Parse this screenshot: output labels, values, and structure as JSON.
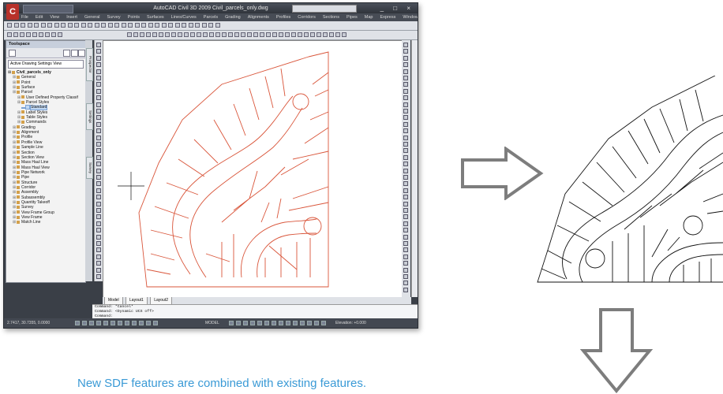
{
  "app": {
    "logo_letter": "C",
    "title": "AutoCAD Civil 3D 2009  Civil_parcels_only.dwg",
    "window_controls": "_ □ ×",
    "menu": [
      "File",
      "Edit",
      "View",
      "Insert",
      "General",
      "Survey",
      "Points",
      "Surfaces",
      "Lines/Curves",
      "Parcels",
      "Grading",
      "Alignments",
      "Profiles",
      "Corridors",
      "Sections",
      "Pipes",
      "Map",
      "Express",
      "Window",
      "Help"
    ]
  },
  "toolspace": {
    "header": "Toolspace",
    "view_selector": "Active Drawing Settings View",
    "tree": [
      {
        "label": "Civil_parcels_only",
        "depth": 0,
        "root": true
      },
      {
        "label": "General",
        "depth": 1
      },
      {
        "label": "Point",
        "depth": 1
      },
      {
        "label": "Surface",
        "depth": 1
      },
      {
        "label": "Parcel",
        "depth": 1
      },
      {
        "label": "User Defined Property Classif",
        "depth": 2
      },
      {
        "label": "Parcel Styles",
        "depth": 2
      },
      {
        "label": "Standard",
        "depth": 3,
        "selected": true
      },
      {
        "label": "Label Styles",
        "depth": 2
      },
      {
        "label": "Table Styles",
        "depth": 2
      },
      {
        "label": "Commands",
        "depth": 2
      },
      {
        "label": "Grading",
        "depth": 1
      },
      {
        "label": "Alignment",
        "depth": 1
      },
      {
        "label": "Profile",
        "depth": 1
      },
      {
        "label": "Profile View",
        "depth": 1
      },
      {
        "label": "Sample Line",
        "depth": 1
      },
      {
        "label": "Section",
        "depth": 1
      },
      {
        "label": "Section View",
        "depth": 1
      },
      {
        "label": "Mass Haul Line",
        "depth": 1
      },
      {
        "label": "Mass Haul View",
        "depth": 1
      },
      {
        "label": "Pipe Network",
        "depth": 1
      },
      {
        "label": "Pipe",
        "depth": 1
      },
      {
        "label": "Structure",
        "depth": 1
      },
      {
        "label": "Corridor",
        "depth": 1
      },
      {
        "label": "Assembly",
        "depth": 1
      },
      {
        "label": "Subassembly",
        "depth": 1
      },
      {
        "label": "Quantity Takeoff",
        "depth": 1
      },
      {
        "label": "Survey",
        "depth": 1
      },
      {
        "label": "View Frame Group",
        "depth": 1
      },
      {
        "label": "View Frame",
        "depth": 1
      },
      {
        "label": "Match Line",
        "depth": 1
      }
    ],
    "side_tabs": [
      "Prospector",
      "Settings",
      "Survey"
    ]
  },
  "layout_tabs": [
    "Model",
    "Layout1",
    "Layout2"
  ],
  "command_lines": [
    "Command: *Cancel*",
    "Command:  <Dynamic UCS off>",
    "Command:"
  ],
  "status": {
    "coords": "2.7417, 30.7355, 0.0000",
    "model": "MODEL",
    "elevation": "Elevation: +0.000"
  },
  "colors": {
    "parcel_lines": "#d9553a",
    "caption": "#3a9ad6",
    "arrow": "#7d7d7d"
  },
  "caption": "New SDF features are combined with existing features."
}
